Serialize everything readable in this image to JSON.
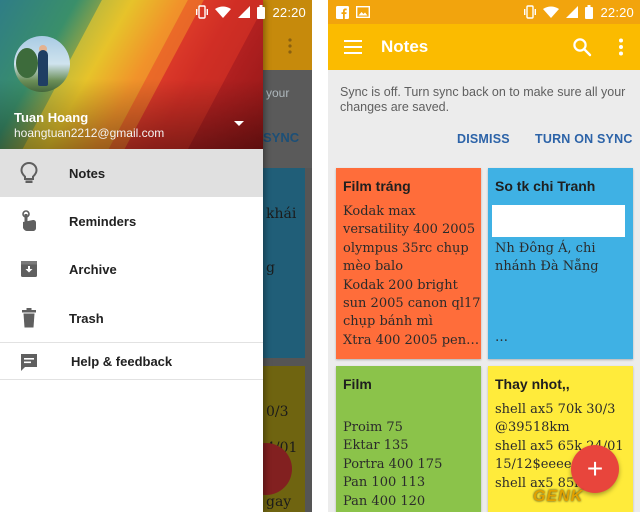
{
  "status_bar": {
    "left_time": "22:20",
    "right_time": "22:20"
  },
  "drawer": {
    "user_name": "Tuan Hoang",
    "user_email": "hoangtuan2212@gmail.com",
    "items": [
      {
        "label": "Notes",
        "icon": "lightbulb-icon",
        "active": true
      },
      {
        "label": "Reminders",
        "icon": "reminder-hand-icon"
      },
      {
        "label": "Archive",
        "icon": "archive-icon"
      },
      {
        "label": "Trash",
        "icon": "trash-icon"
      },
      {
        "label": "Help & feedback",
        "icon": "feedback-icon"
      }
    ]
  },
  "behind_drawer": {
    "fragments": [
      "your",
      "SYNC",
      "khái",
      "g",
      "0/3",
      "4/01",
      "gay"
    ]
  },
  "app": {
    "title": "Notes",
    "header_color": "#fbbb00",
    "statusbar_color": "#f2a40d"
  },
  "sync_banner": {
    "message": "Sync is off. Turn sync back on to make sure all your changes are saved.",
    "dismiss": "DISMISS",
    "turn_on": "TURN ON SYNC"
  },
  "notes": [
    {
      "title": "Film tráng",
      "color": "#ff6d3a",
      "body": "Kodak max\nversatility 400 2005\nolympus 35rc chụp\nmèo balo\nKodak 200 bright\nsun 2005 canon ql17\nchụp bánh mì\nXtra 400 2005 pen…"
    },
    {
      "title": "So tk chi Tranh",
      "color": "#3fb1e4",
      "body": "Nh Đông Á, chi\nnhánh Đà Nẵng",
      "footer": "…"
    },
    {
      "title": "Film",
      "color": "#8bc34a",
      "body": "Proim 75\nEktar 135\nPortra 400 175\nPan 100 113\nPan 400 120"
    },
    {
      "title": "Thay nhot,,",
      "color": "#ffeb3b",
      "body": "shell ax5 70k 30/3\n@39518km\nshell ax5 65k 24/01\n15/12$eeeee\nshell ax5 85k"
    }
  ],
  "fab": {
    "label": "+"
  },
  "watermark": "GENK"
}
